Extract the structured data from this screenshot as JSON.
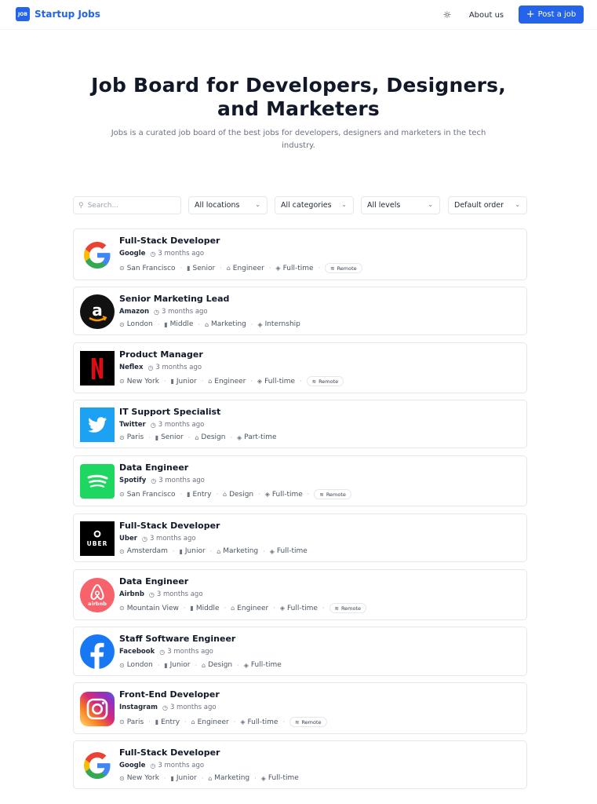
{
  "header": {
    "brand_logo_text": "JOB",
    "brand_name": "Startup Jobs",
    "about_label": "About us",
    "post_label": "Post a job"
  },
  "hero": {
    "title": "Job Board for Developers, Designers, and Marketers",
    "subtitle": "Jobs is a curated job board of the best jobs for developers, designers and marketers in the tech industry."
  },
  "filters": {
    "search_placeholder": "Search...",
    "location": "All locations",
    "category": "All categories",
    "level": "All levels",
    "order": "Default order"
  },
  "colors": {
    "accent": "#2563eb"
  },
  "jobs": [
    {
      "title": "Full-Stack Developer",
      "company": "Google",
      "time": "3 months ago",
      "location": "San Francisco",
      "level": "Senior",
      "category": "Engineer",
      "type": "Full-time",
      "remote": "Remote",
      "logo": "google-logo"
    },
    {
      "title": "Senior Marketing Lead",
      "company": "Amazon",
      "time": "3 months ago",
      "location": "London",
      "level": "Middle",
      "category": "Marketing",
      "type": "Internship",
      "remote": "",
      "logo": "amazon-logo"
    },
    {
      "title": "Product Manager",
      "company": "Neflex",
      "time": "3 months ago",
      "location": "New York",
      "level": "Junior",
      "category": "Engineer",
      "type": "Full-time",
      "remote": "Remote",
      "logo": "netflix-logo"
    },
    {
      "title": "IT Support Specialist",
      "company": "Twitter",
      "time": "3 months ago",
      "location": "Paris",
      "level": "Senior",
      "category": "Design",
      "type": "Part-time",
      "remote": "",
      "logo": "twitter-logo"
    },
    {
      "title": "Data Engineer",
      "company": "Spotify",
      "time": "3 months ago",
      "location": "San Francisco",
      "level": "Entry",
      "category": "Design",
      "type": "Full-time",
      "remote": "Remote",
      "logo": "spotify-logo"
    },
    {
      "title": "Full-Stack Developer",
      "company": "Uber",
      "time": "3 months ago",
      "location": "Amsterdam",
      "level": "Junior",
      "category": "Marketing",
      "type": "Full-time",
      "remote": "",
      "logo": "uber-logo",
      "logo_text": "UBER"
    },
    {
      "title": "Data Engineer",
      "company": "Airbnb",
      "time": "3 months ago",
      "location": "Mountain View",
      "level": "Middle",
      "category": "Engineer",
      "type": "Full-time",
      "remote": "Remote",
      "logo": "airbnb-logo",
      "logo_text": "airbnb"
    },
    {
      "title": "Staff Software Engineer",
      "company": "Facebook",
      "time": "3 months ago",
      "location": "London",
      "level": "Junior",
      "category": "Design",
      "type": "Full-time",
      "remote": "",
      "logo": "facebook-logo"
    },
    {
      "title": "Front-End Developer",
      "company": "Instagram",
      "time": "3 months ago",
      "location": "Paris",
      "level": "Entry",
      "category": "Engineer",
      "type": "Full-time",
      "remote": "Remote",
      "logo": "instagram-logo"
    },
    {
      "title": "Full-Stack Developer",
      "company": "Google",
      "time": "3 months ago",
      "location": "New York",
      "level": "Junior",
      "category": "Marketing",
      "type": "Full-time",
      "remote": "",
      "logo": "google-logo"
    }
  ]
}
